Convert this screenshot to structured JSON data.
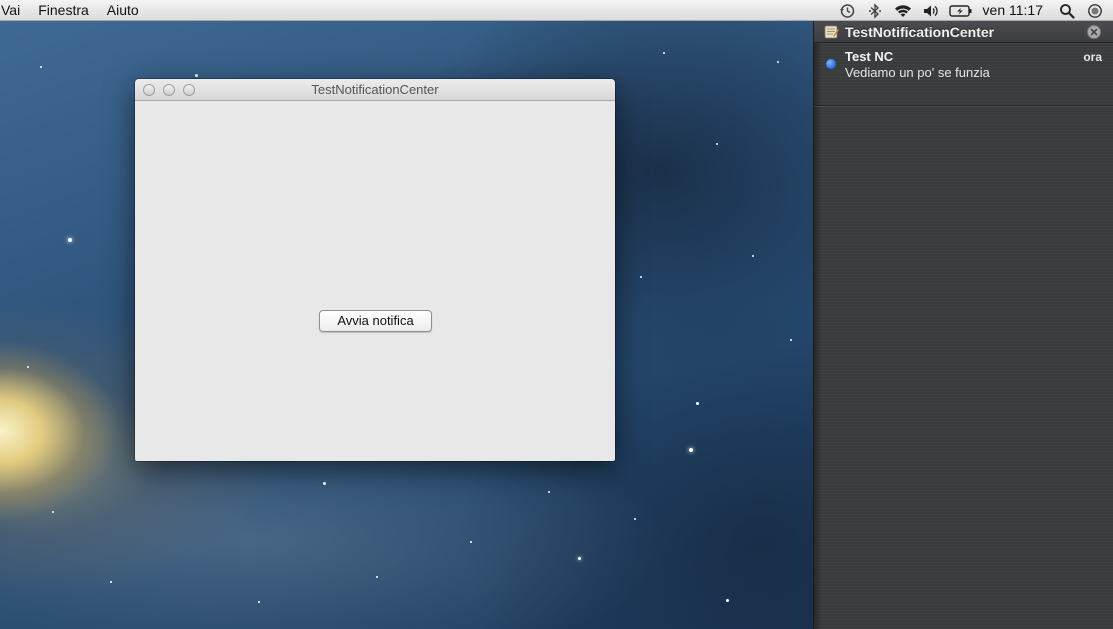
{
  "menubar": {
    "items": [
      "Vai",
      "Finestra",
      "Aiuto"
    ],
    "clock": "ven 11:17",
    "status_icons": [
      "time-machine-icon",
      "bluetooth-icon",
      "wifi-icon",
      "volume-icon",
      "battery-icon",
      "spotlight-search-icon",
      "notification-center-icon"
    ]
  },
  "window": {
    "title": "TestNotificationCenter",
    "button_label": "Avvia notifica"
  },
  "notification_center": {
    "app_name": "TestNotificationCenter",
    "notification": {
      "title": "Test NC",
      "body": "Vediamo un po' se funzia",
      "time": "ora",
      "unread_dot_color": "#2f76e6"
    }
  }
}
